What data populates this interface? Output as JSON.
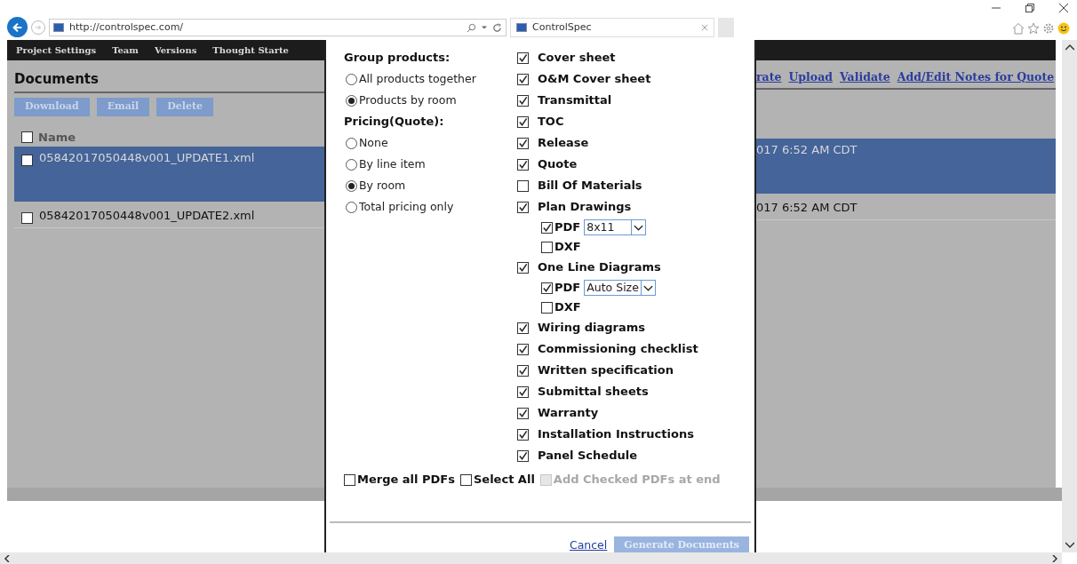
{
  "browser": {
    "url": "http://controlspec.com/",
    "tab_title": "ControlSpec"
  },
  "nav": [
    "Project Settings",
    "Team",
    "Versions",
    "Thought Starte"
  ],
  "documents": {
    "title": "Documents",
    "buttons": [
      "Download",
      "Email",
      "Delete"
    ],
    "links": [
      "rate",
      "Upload",
      "Validate",
      "Add/Edit Notes for Quote"
    ],
    "header": {
      "label": "Name",
      "checked": false
    },
    "rows": [
      {
        "name": "05842017050448v001_UPDATE1.xml",
        "date": "017 6:52 AM CDT",
        "selected": true,
        "checked": false
      },
      {
        "name": "05842017050448v001_UPDATE2.xml",
        "date": "017 6:52 AM CDT",
        "selected": false,
        "checked": false
      }
    ]
  },
  "dialog": {
    "groups": [
      {
        "label": "Group products:",
        "options": [
          {
            "label": "All products together",
            "selected": false
          },
          {
            "label": "Products by room",
            "selected": true
          }
        ]
      },
      {
        "label": "Pricing(Quote):",
        "options": [
          {
            "label": "None",
            "selected": false
          },
          {
            "label": "By line item",
            "selected": false
          },
          {
            "label": "By room",
            "selected": true
          },
          {
            "label": "Total pricing only",
            "selected": false
          }
        ]
      }
    ],
    "items": [
      {
        "label": "Cover sheet",
        "checked": true
      },
      {
        "label": "O&M Cover sheet",
        "checked": true
      },
      {
        "label": "Transmittal",
        "checked": true
      },
      {
        "label": "TOC",
        "checked": true
      },
      {
        "label": "Release",
        "checked": true
      },
      {
        "label": "Quote",
        "checked": true
      },
      {
        "label": "Bill Of Materials",
        "checked": false
      },
      {
        "label": "Plan Drawings",
        "checked": true,
        "children": [
          {
            "label": "PDF",
            "checked": true,
            "size": "8x11"
          },
          {
            "label": "DXF",
            "checked": false
          }
        ]
      },
      {
        "label": "One Line Diagrams",
        "checked": true,
        "children": [
          {
            "label": "PDF",
            "checked": true,
            "size": "Auto Size"
          },
          {
            "label": "DXF",
            "checked": false
          }
        ]
      },
      {
        "label": "Wiring diagrams",
        "checked": true
      },
      {
        "label": "Commissioning checklist",
        "checked": true
      },
      {
        "label": "Written specification",
        "checked": true
      },
      {
        "label": "Submittal sheets",
        "checked": true
      },
      {
        "label": "Warranty",
        "checked": true
      },
      {
        "label": "Installation Instructions",
        "checked": true
      },
      {
        "label": "Panel Schedule",
        "checked": true
      }
    ],
    "footer_options": [
      {
        "label": "Merge all PDFs",
        "checked": false,
        "disabled": false
      },
      {
        "label": "Select All",
        "checked": false,
        "disabled": false
      },
      {
        "label": "Add Checked PDFs at end",
        "checked": false,
        "disabled": true
      }
    ],
    "cancel": "Cancel",
    "generate": {
      "label": "Generate Documents",
      "disabled": true
    }
  }
}
